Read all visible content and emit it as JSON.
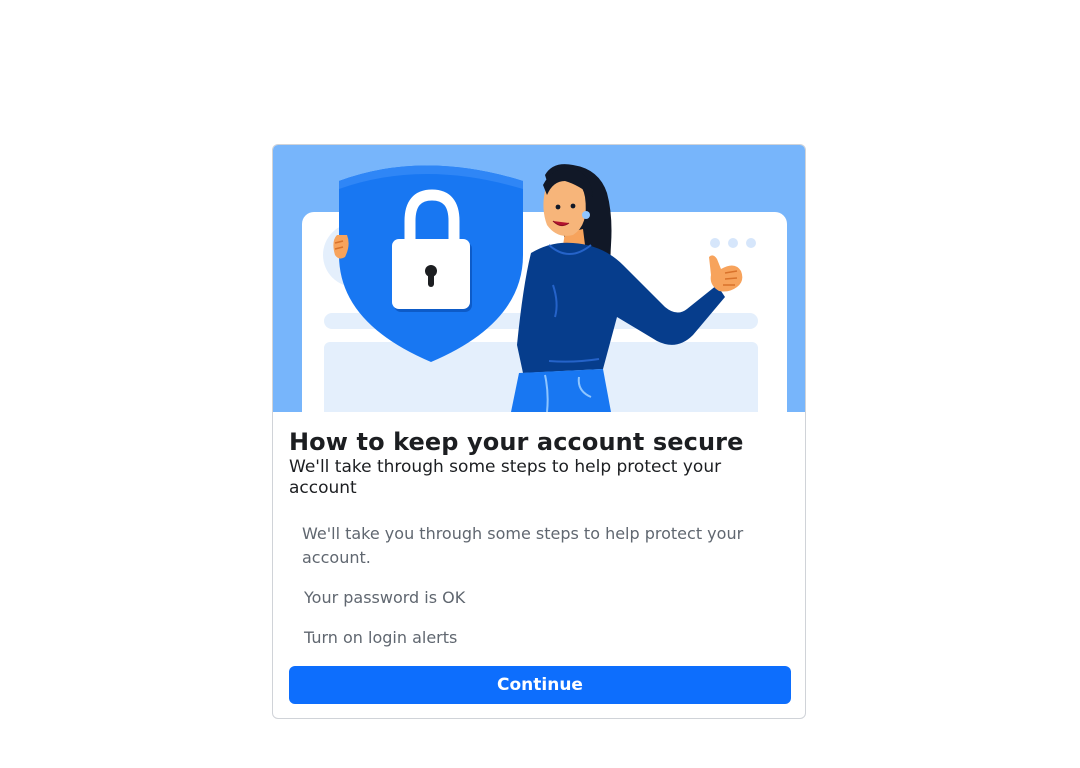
{
  "dialog": {
    "title": "How to keep your account secure",
    "subtitle": "We'll take through some steps to help protect your account",
    "steps": [
      "We'll take you through some steps to help protect your account.",
      "Your password is OK",
      "Turn on login alerts"
    ],
    "continue_label": "Continue"
  },
  "colors": {
    "hero_background": "#77b5fb",
    "shield": "#1877f2",
    "button": "#0d6efd",
    "sweater": "#063d8c"
  },
  "illustration": {
    "icons": [
      "shield-icon",
      "lock-icon",
      "woman-illustration",
      "thumbs-up-icon"
    ]
  }
}
